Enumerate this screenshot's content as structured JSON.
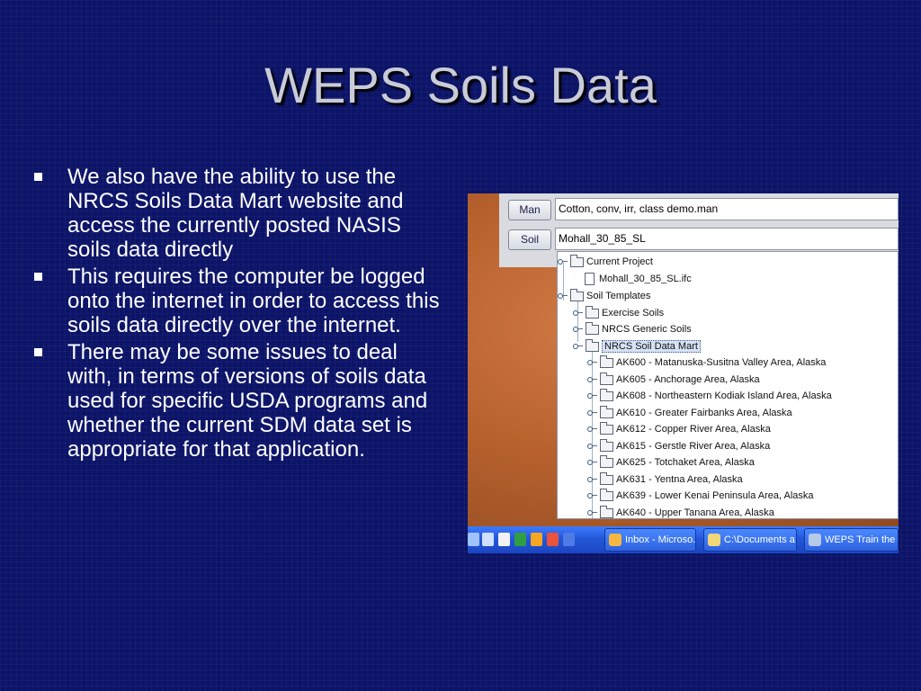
{
  "slide": {
    "title": "WEPS Soils Data",
    "bullets": [
      "We also have the ability to use the NRCS Soils Data Mart website and access the currently posted NASIS soils data directly",
      "This requires the computer be logged onto the internet in order to access this soils data directly over the internet.",
      "There may be some issues to deal with, in terms of versions of soils data used for specific USDA programs and whether the current SDM data set is appropriate for that application."
    ]
  },
  "screenshot": {
    "man_button": "Man",
    "man_value": "Cotton, conv, irr, class demo.man",
    "soil_button": "Soil",
    "soil_value": "Mohall_30_85_SL",
    "tree": {
      "current_project": "Current Project",
      "project_file": "Mohall_30_85_SL.ifc",
      "soil_templates": "Soil Templates",
      "exercise_soils": "Exercise Soils",
      "nrcs_generic": "NRCS Generic Soils",
      "nrcs_sdm": "NRCS Soil Data Mart",
      "areas": [
        "AK600 - Matanuska-Susitna Valley Area, Alaska",
        "AK605 - Anchorage Area, Alaska",
        "AK608 - Northeastern Kodiak Island Area, Alaska",
        "AK610 - Greater Fairbanks Area, Alaska",
        "AK612 - Copper River Area, Alaska",
        "AK615 - Gerstle River Area, Alaska",
        "AK625 - Totchaket Area, Alaska",
        "AK631 - Yentna Area, Alaska",
        "AK639 - Lower Kenai Peninsula Area, Alaska",
        "AK640 - Upper Tanana Area, Alaska"
      ]
    },
    "taskbar": {
      "tasks": [
        "Inbox - Microso...",
        "C:\\Documents a...",
        "WEPS Train the ..."
      ]
    }
  },
  "colors": {
    "background": "#0c1468",
    "title": "#c9ccd8",
    "taskbar": "#2457d8"
  }
}
